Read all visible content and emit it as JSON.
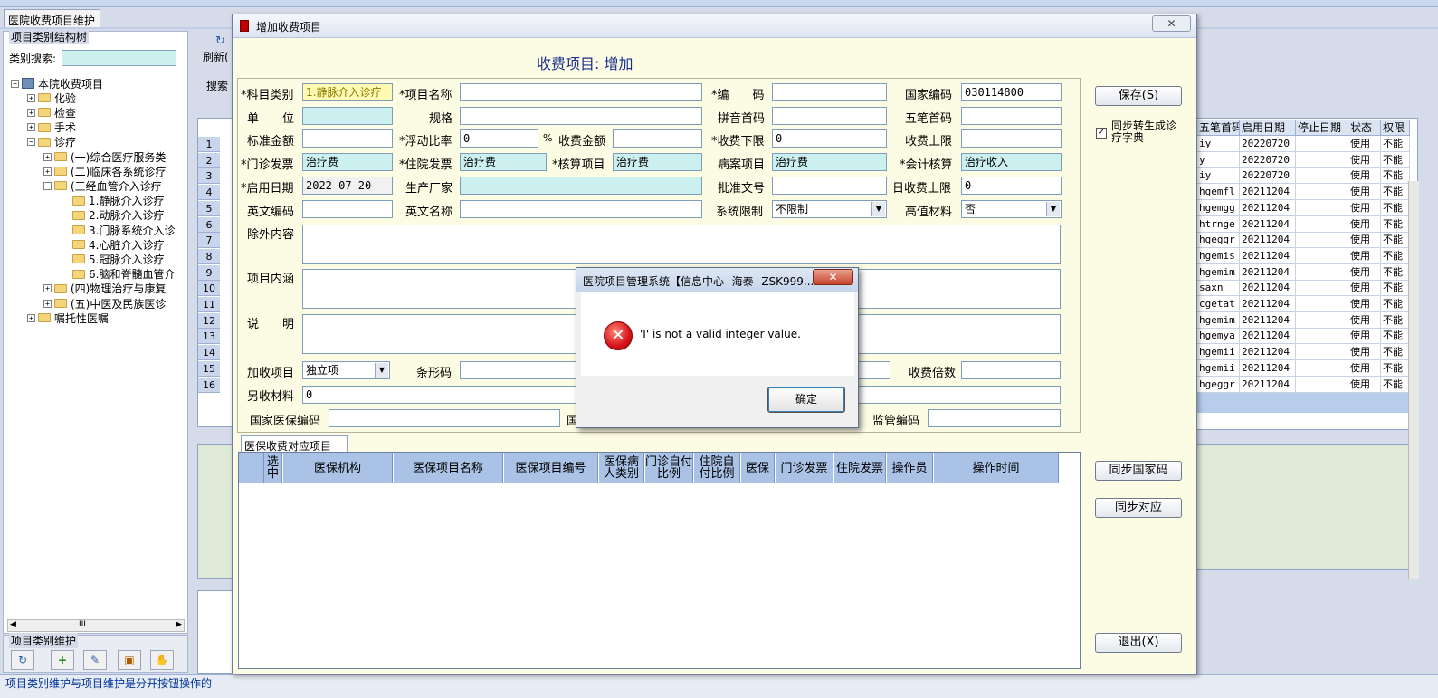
{
  "main_tab": {
    "label": "医院收费项目维护"
  },
  "left": {
    "group_title": "项目类别结构树",
    "search_label": "类别搜索:",
    "tree": [
      {
        "label": "本院收费项目",
        "level": 0,
        "expander": "⊟"
      },
      {
        "label": "化验",
        "level": 1,
        "expander": "⊞"
      },
      {
        "label": "检查",
        "level": 1,
        "expander": "⊞"
      },
      {
        "label": "手术",
        "level": 1,
        "expander": "⊞"
      },
      {
        "label": "诊疗",
        "level": 1,
        "expander": "⊟"
      },
      {
        "label": "(一)综合医疗服务类",
        "level": 2,
        "expander": "⊞"
      },
      {
        "label": "(二)临床各系统诊疗",
        "level": 2,
        "expander": "⊞"
      },
      {
        "label": "(三经血管介入诊疗",
        "level": 2,
        "expander": "⊟"
      },
      {
        "label": "1.静脉介入诊疗",
        "level": 3,
        "expander": ""
      },
      {
        "label": "2.动脉介入诊疗",
        "level": 3,
        "expander": ""
      },
      {
        "label": "3.门脉系统介入诊",
        "level": 3,
        "expander": ""
      },
      {
        "label": "4.心脏介入诊疗",
        "level": 3,
        "expander": ""
      },
      {
        "label": "5.冠脉介入诊疗",
        "level": 3,
        "expander": ""
      },
      {
        "label": "6.脑和脊髓血管介",
        "level": 3,
        "expander": ""
      },
      {
        "label": "(四)物理治疗与康复",
        "level": 2,
        "expander": "⊞"
      },
      {
        "label": "(五)中医及民族医诊",
        "level": 2,
        "expander": "⊞"
      },
      {
        "label": "嘱托性医嘱",
        "level": 1,
        "expander": "⊞"
      }
    ],
    "scroll_label": "III",
    "maint_title": "项目类别维护",
    "status_text": "项目类别维护与项目维护是分开按钮操作的"
  },
  "middle": {
    "refresh_label": "刷新(",
    "search_label": "搜索",
    "row_numbers": [
      "1",
      "2",
      "3",
      "4",
      "5",
      "6",
      "7",
      "8",
      "9",
      "10",
      "11",
      "12",
      "13",
      "14",
      "15",
      "16"
    ]
  },
  "right_grid": {
    "headers": [
      "五笔首码",
      "启用日期",
      "停止日期",
      "状态",
      "权限"
    ],
    "rows": [
      [
        "iy",
        "20220720",
        "",
        "使用",
        "不能"
      ],
      [
        "y",
        "20220720",
        "",
        "使用",
        "不能"
      ],
      [
        "iy",
        "20220720",
        "",
        "使用",
        "不能"
      ],
      [
        "hgemfl",
        "20211204",
        "",
        "使用",
        "不能"
      ],
      [
        "hgemgg",
        "20211204",
        "",
        "使用",
        "不能"
      ],
      [
        "htrnge",
        "20211204",
        "",
        "使用",
        "不能"
      ],
      [
        "hgeggr",
        "20211204",
        "",
        "使用",
        "不能"
      ],
      [
        "hgemis",
        "20211204",
        "",
        "使用",
        "不能"
      ],
      [
        "hgemim",
        "20211204",
        "",
        "使用",
        "不能"
      ],
      [
        "saxn",
        "20211204",
        "",
        "使用",
        "不能"
      ],
      [
        "cgetat",
        "20211204",
        "",
        "使用",
        "不能"
      ],
      [
        "hgemim",
        "20211204",
        "",
        "使用",
        "不能"
      ],
      [
        "hgemya",
        "20211204",
        "",
        "使用",
        "不能"
      ],
      [
        "hgemii",
        "20211204",
        "",
        "使用",
        "不能"
      ],
      [
        "hgemii",
        "20211204",
        "",
        "使用",
        "不能"
      ],
      [
        "hgeggr",
        "20211204",
        "",
        "使用",
        "不能"
      ]
    ]
  },
  "dialog": {
    "title": "增加收费项目",
    "close_glyph": "✕",
    "heading": "收费项目: 增加",
    "fields": {
      "subject_category": {
        "label": "*科目类别",
        "value": "1.静脉介入诊疗"
      },
      "item_name": {
        "label": "*项目名称",
        "value": ""
      },
      "code": {
        "label": "*编　　码",
        "value": ""
      },
      "national_code": {
        "label": "国家编码",
        "value": "030114800"
      },
      "unit": {
        "label": "单　　位",
        "value": ""
      },
      "spec": {
        "label": "规格",
        "value": ""
      },
      "pinyin_code": {
        "label": "拼音首码",
        "value": ""
      },
      "wubi_code": {
        "label": "五笔首码",
        "value": ""
      },
      "standard_amount": {
        "label": "标准金额",
        "value": ""
      },
      "float_ratio": {
        "label": "*浮动比率",
        "value": "0"
      },
      "percent": {
        "label": "%"
      },
      "charge_amount": {
        "label": "收费金额",
        "value": ""
      },
      "charge_lower": {
        "label": "*收费下限",
        "value": "0"
      },
      "charge_upper": {
        "label": "收费上限",
        "value": ""
      },
      "outpatient_invoice": {
        "label": "*门诊发票",
        "value": "治疗费"
      },
      "inpatient_invoice": {
        "label": "*住院发票",
        "value": "治疗费"
      },
      "accounting_item": {
        "label": "*核算项目",
        "value": "治疗费"
      },
      "medical_record_item": {
        "label": "病案项目",
        "value": "治疗费"
      },
      "accounting": {
        "label": "*会计核算",
        "value": "治疗收入"
      },
      "start_date": {
        "label": "*启用日期",
        "value": "2022-07-20"
      },
      "manufacturer": {
        "label": "生产厂家",
        "value": ""
      },
      "approval_no": {
        "label": "批准文号",
        "value": ""
      },
      "daily_upper": {
        "label": "日收费上限",
        "value": "0"
      },
      "english_code": {
        "label": "英文编码",
        "value": ""
      },
      "english_name": {
        "label": "英文名称",
        "value": ""
      },
      "system_limit": {
        "label": "系统限制",
        "value": "不限制"
      },
      "high_value": {
        "label": "高值材料",
        "value": "否"
      },
      "exclusions": {
        "label": "除外内容",
        "value": ""
      },
      "item_content": {
        "label": "项目内涵",
        "value": ""
      },
      "description": {
        "label": "说　　明",
        "value": ""
      },
      "add_charge": {
        "label": "加收项目",
        "value": "独立项"
      },
      "barcode": {
        "label": "条形码",
        "value": ""
      },
      "multiple": {
        "label": "收费倍数",
        "value": ""
      },
      "extra_material": {
        "label": "另收材料",
        "value": "0"
      },
      "national_insurance_code": {
        "label": "国家医保编码",
        "value": ""
      },
      "national_partial": {
        "label": "国"
      },
      "supervision_code": {
        "label": "监管编码",
        "value": ""
      }
    },
    "buttons": {
      "save": "保存(S)",
      "sync_dict_label": "同步转生成诊疗字典",
      "sync_national": "同步国家码",
      "sync_mapping": "同步对应",
      "exit": "退出(X)"
    },
    "ins_tab": "医保收费对应项目",
    "ins_headers": [
      "选中",
      "医保机构",
      "医保项目名称",
      "医保项目编号",
      "医保病人类别",
      "门诊自付比例",
      "住院自付比例",
      "医保",
      "门诊发票",
      "住院发票",
      "操作员",
      "操作时间"
    ]
  },
  "message_box": {
    "title": "医院项目管理系统【信息中心--海泰--ZSK999...",
    "close_glyph": "✕",
    "icon_glyph": "✕",
    "text": "'I' is not a valid integer value.",
    "ok": "确定"
  }
}
